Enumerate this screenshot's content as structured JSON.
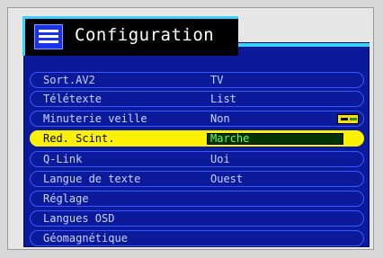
{
  "menu": {
    "title": "Configuration",
    "icon": "menu-list-icon",
    "items": [
      {
        "label": "Sort.AV2",
        "value": "TV"
      },
      {
        "label": "Télétexte",
        "value": "List"
      },
      {
        "label": "Minuterie veille",
        "value": "Non"
      },
      {
        "label": "Red. Scint.",
        "value": "Marche"
      },
      {
        "label": "Q-Link",
        "value": "Uoi"
      },
      {
        "label": "Langue de texte",
        "value": "Ouest"
      },
      {
        "label": "Réglage",
        "value": ""
      },
      {
        "label": "Langues OSD",
        "value": ""
      },
      {
        "label": "Géomagnétique",
        "value": ""
      }
    ],
    "selected_index": 3
  },
  "colors": {
    "panel": "#0b1a9a",
    "highlight": "#fff200",
    "accent": "#3ad0ff"
  }
}
